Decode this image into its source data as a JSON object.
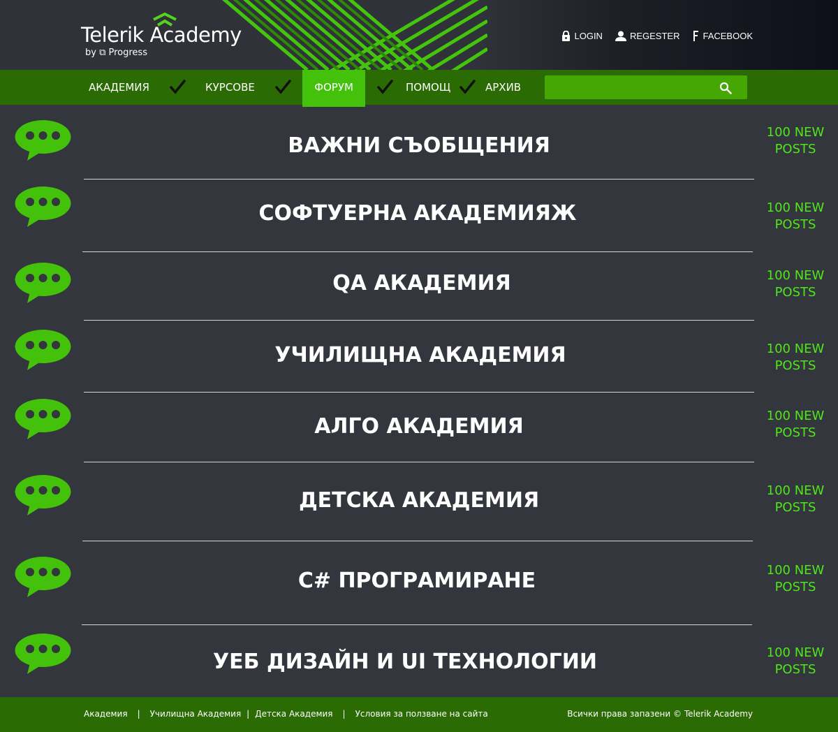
{
  "header": {
    "logo_title": "Telerik Academy",
    "logo_by": "by ⧉ Progress",
    "top_links": [
      {
        "label": "LOGIN",
        "icon": "lock-icon"
      },
      {
        "label": "REGESTER",
        "icon": "user-icon"
      },
      {
        "label": "FACEBOOK",
        "icon": "facebook-icon"
      }
    ]
  },
  "nav": {
    "items": [
      {
        "label": "АКАДЕМИЯ",
        "active": false
      },
      {
        "label": "КУРСОВЕ",
        "active": false
      },
      {
        "label": "ФОРУМ",
        "active": true
      },
      {
        "label": "ПОМОЩ",
        "active": false
      },
      {
        "label": "АРХИВ",
        "active": false
      }
    ],
    "search": {
      "value": "",
      "placeholder": ""
    }
  },
  "forums": [
    {
      "title": "ВАЖНИ СЪОБЩЕНИЯ",
      "posts_line1": "100 NEW",
      "posts_line2": "POSTS"
    },
    {
      "title": "СОФТУЕРНА АКАДЕМИЯЖ",
      "posts_line1": "100 NEW",
      "posts_line2": "POSTS"
    },
    {
      "title": "QA АКАДЕМИЯ",
      "posts_line1": "100 NEW",
      "posts_line2": "POSTS"
    },
    {
      "title": "УЧИЛИЩНА АКАДЕМИЯ",
      "posts_line1": "100 NEW",
      "posts_line2": "POSTS"
    },
    {
      "title": "АЛГО АКАДЕМИЯ",
      "posts_line1": "100 NEW",
      "posts_line2": "POSTS"
    },
    {
      "title": "ДЕТСКА АКАДЕМИЯ",
      "posts_line1": "100 NEW",
      "posts_line2": "POSTS"
    },
    {
      "title": "C# ПРОГРАМИРАНЕ",
      "posts_line1": "100 NEW",
      "posts_line2": "POSTS"
    },
    {
      "title": "УЕБ ДИЗАЙН И UI ТЕХНОЛОГИИ",
      "posts_line1": "100 NEW",
      "posts_line2": "POSTS"
    }
  ],
  "footer": {
    "links": [
      "Академия",
      "Училищна Академия",
      "Детска Академия",
      "Условия за ползване на сайта"
    ],
    "separator": "|",
    "copyright": "Всички права запазени  ©  Telerik Academy"
  },
  "colors": {
    "accent_green": "#43c10b",
    "nav_green": "#2b6b04",
    "posts_green": "#4fe61a",
    "background": "#33363c"
  }
}
